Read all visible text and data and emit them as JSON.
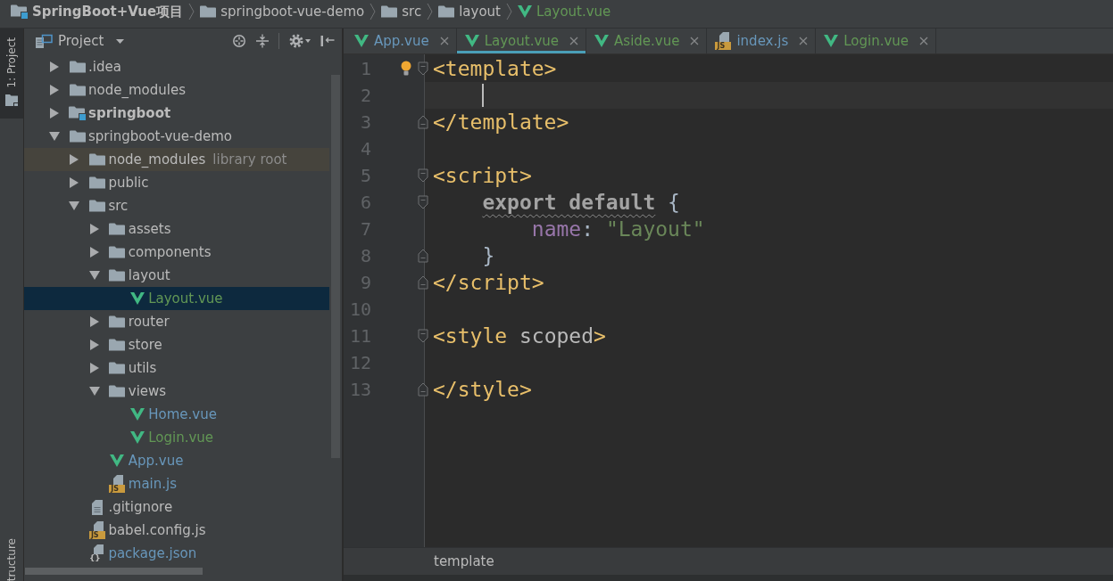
{
  "navigation_bar": {
    "items": [
      {
        "label": "SpringBoot+Vue项目",
        "kind": "project",
        "color": "#bbbbbb"
      },
      {
        "label": "springboot-vue-demo",
        "kind": "folder",
        "color": "#bbbbbb"
      },
      {
        "label": "src",
        "kind": "folder",
        "color": "#bbbbbb"
      },
      {
        "label": "layout",
        "kind": "folder",
        "color": "#bbbbbb"
      },
      {
        "label": "Layout.vue",
        "kind": "vue",
        "color": "#629755"
      }
    ]
  },
  "tool_strip": {
    "top_tabs": [
      {
        "label": "1: Project",
        "selected": true
      }
    ],
    "bottom_tabs": [
      {
        "label": "tructure",
        "selected": false
      }
    ]
  },
  "project_panel": {
    "title": "Project",
    "tree": [
      {
        "label": ".idea",
        "kind": "folder",
        "expanded": false,
        "selected": false,
        "color": "#bbbbbb"
      },
      {
        "label": "node_modules",
        "kind": "folder",
        "expanded": false,
        "selected": false,
        "color": "#bbbbbb"
      },
      {
        "label": "springboot",
        "kind": "module",
        "expanded": false,
        "selected": false,
        "color": "#bbbbbb"
      },
      {
        "label": "springboot-vue-demo",
        "kind": "folder",
        "expanded": true,
        "selected": false,
        "color": "#bbbbbb",
        "children": [
          {
            "label": "node_modules",
            "note": "library root",
            "kind": "library",
            "expanded": false,
            "selected": false,
            "color": "#bbbbbb"
          },
          {
            "label": "public",
            "kind": "folder",
            "expanded": false,
            "selected": false,
            "color": "#bbbbbb"
          },
          {
            "label": "src",
            "kind": "folder",
            "expanded": true,
            "selected": false,
            "color": "#bbbbbb",
            "children": [
              {
                "label": "assets",
                "kind": "folder",
                "expanded": false,
                "selected": false,
                "color": "#bbbbbb"
              },
              {
                "label": "components",
                "kind": "folder",
                "expanded": false,
                "selected": false,
                "color": "#bbbbbb"
              },
              {
                "label": "layout",
                "kind": "folder",
                "expanded": true,
                "selected": false,
                "color": "#bbbbbb",
                "children": [
                  {
                    "label": "Layout.vue",
                    "kind": "vue",
                    "selected": true,
                    "color": "#629755"
                  }
                ]
              },
              {
                "label": "router",
                "kind": "folder",
                "expanded": false,
                "selected": false,
                "color": "#bbbbbb"
              },
              {
                "label": "store",
                "kind": "folder",
                "expanded": false,
                "selected": false,
                "color": "#bbbbbb"
              },
              {
                "label": "utils",
                "kind": "folder",
                "expanded": false,
                "selected": false,
                "color": "#bbbbbb"
              },
              {
                "label": "views",
                "kind": "folder",
                "expanded": true,
                "selected": false,
                "color": "#bbbbbb",
                "children": [
                  {
                    "label": "Home.vue",
                    "kind": "vue",
                    "selected": false,
                    "color": "#6897bb"
                  },
                  {
                    "label": "Login.vue",
                    "kind": "vue",
                    "selected": false,
                    "color": "#629755"
                  }
                ]
              },
              {
                "label": "App.vue",
                "kind": "vue",
                "selected": false,
                "color": "#6897bb"
              },
              {
                "label": "main.js",
                "kind": "js",
                "badge": "JS",
                "selected": false,
                "color": "#6897bb"
              }
            ]
          },
          {
            "label": ".gitignore",
            "kind": "text",
            "selected": false,
            "color": "#bbbbbb"
          },
          {
            "label": "babel.config.js",
            "kind": "js",
            "badge": "JS",
            "selected": false,
            "color": "#bbbbbb"
          },
          {
            "label": "package.json",
            "kind": "json",
            "badge": "{}",
            "selected": false,
            "color": "#6897bb"
          }
        ]
      }
    ]
  },
  "editor_tabs": [
    {
      "label": "App.vue",
      "kind": "vue",
      "selected": false,
      "color": "#6897bb"
    },
    {
      "label": "Layout.vue",
      "kind": "vue",
      "selected": true,
      "color": "#629755"
    },
    {
      "label": "Aside.vue",
      "kind": "vue",
      "selected": false,
      "color": "#629755"
    },
    {
      "label": "index.js",
      "kind": "js",
      "badge": "JS",
      "selected": false,
      "color": "#6897bb"
    },
    {
      "label": "Login.vue",
      "kind": "vue",
      "selected": false,
      "color": "#629755"
    }
  ],
  "editor": {
    "lines": [
      {
        "number": "1",
        "fold_start": true,
        "fold_end": false,
        "current": false,
        "bulb": true,
        "tokens": [
          {
            "kind": "tag",
            "text": "<template>"
          }
        ]
      },
      {
        "number": "2",
        "fold_start": false,
        "fold_end": false,
        "current": true,
        "bulb": false
      },
      {
        "number": "3",
        "fold_start": false,
        "fold_end": true,
        "current": false,
        "bulb": false,
        "tokens": [
          {
            "kind": "tag",
            "text": "</template>"
          }
        ]
      },
      {
        "number": "4",
        "fold_start": false,
        "fold_end": false,
        "current": false,
        "bulb": false
      },
      {
        "number": "5",
        "fold_start": true,
        "fold_end": false,
        "current": false,
        "bulb": false,
        "tokens": [
          {
            "kind": "tag",
            "text": "<script>"
          }
        ]
      },
      {
        "number": "6",
        "fold_start": true,
        "fold_end": false,
        "current": false,
        "bulb": false,
        "tokens": [
          {
            "kind": "flagged",
            "text": "    export default"
          },
          {
            "kind": "plain",
            "text": " {"
          }
        ]
      },
      {
        "number": "7",
        "fold_start": false,
        "fold_end": false,
        "current": false,
        "bulb": false,
        "tokens": [
          {
            "kind": "property",
            "text": "        name"
          },
          {
            "kind": "plain",
            "text": ": "
          },
          {
            "kind": "string",
            "text": "\"Layout\""
          }
        ]
      },
      {
        "number": "8",
        "fold_start": false,
        "fold_end": true,
        "current": false,
        "bulb": false,
        "tokens": [
          {
            "kind": "plain",
            "text": "    }"
          }
        ]
      },
      {
        "number": "9",
        "fold_start": false,
        "fold_end": true,
        "current": false,
        "bulb": false,
        "tokens": [
          {
            "kind": "tag",
            "text": "</script>"
          }
        ]
      },
      {
        "number": "10",
        "fold_start": false,
        "fold_end": false,
        "current": false,
        "bulb": false
      },
      {
        "number": "11",
        "fold_start": true,
        "fold_end": false,
        "current": false,
        "bulb": false,
        "tokens": [
          {
            "kind": "tag",
            "text": "<style"
          },
          {
            "kind": "attribute",
            "text": " scoped"
          },
          {
            "kind": "tag",
            "text": ">"
          }
        ]
      },
      {
        "number": "12",
        "fold_start": false,
        "fold_end": false,
        "current": false,
        "bulb": false
      },
      {
        "number": "13",
        "fold_start": false,
        "fold_end": true,
        "current": false,
        "bulb": false,
        "tokens": [
          {
            "kind": "tag",
            "text": "</style>"
          }
        ]
      }
    ]
  },
  "editor_breadcrumb": {
    "items": [
      "template"
    ]
  }
}
